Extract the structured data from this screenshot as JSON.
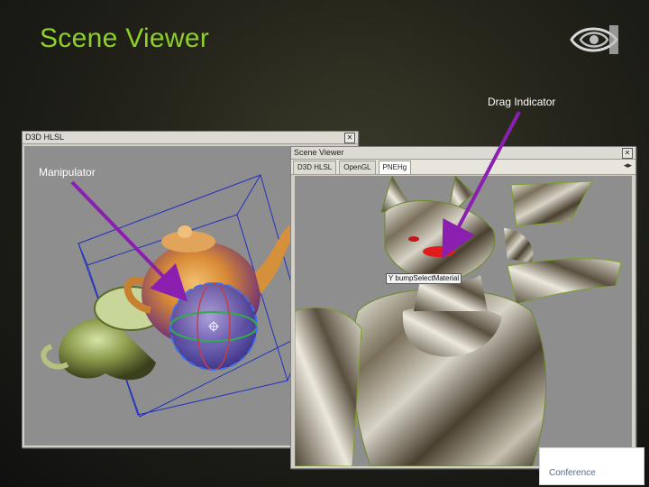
{
  "slide": {
    "title": "Scene Viewer",
    "brand_color": "#8fcf2a"
  },
  "annotations": {
    "manipulator": "Manipulator",
    "drag_indicator": "Drag Indicator",
    "arrow_color": "#8a1fb0"
  },
  "left_window": {
    "title": "D3D HLSL",
    "close_icon": "close-icon"
  },
  "right_window": {
    "title": "Scene Viewer",
    "tabs": [
      "D3D HLSL",
      "OpenGL",
      "PNEHg"
    ],
    "active_tab": "PNEHg",
    "scroll_arrows": "◂▸",
    "object_label": "Y bumpSelectMaterial"
  },
  "corner_tag": {
    "text": "Conference"
  }
}
